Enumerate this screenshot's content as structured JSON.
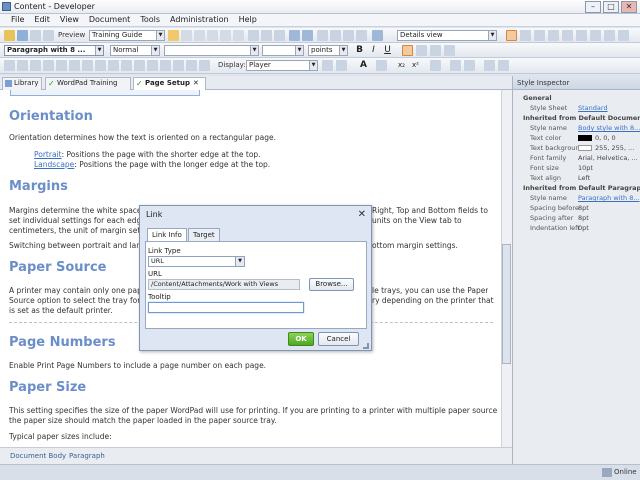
{
  "window": {
    "title": "Content - Developer"
  },
  "menu": [
    "File",
    "Edit",
    "View",
    "Document",
    "Tools",
    "Administration",
    "Help"
  ],
  "toolbar1": {
    "preview_label": "Preview",
    "guide_select": "Training Guide",
    "view_select": "Details view"
  },
  "toolbar2": {
    "style_select": "Paragraph with 8 ...",
    "font_select": "Normal",
    "size_units": "points"
  },
  "toolbar3": {
    "display_label": "Display:",
    "display_select": "Player"
  },
  "tabs": [
    {
      "label": "Library"
    },
    {
      "label": "WordPad Training"
    },
    {
      "label": "Page Setup"
    }
  ],
  "document": {
    "orientation": {
      "heading": "Orientation",
      "body": "Orientation determines how the text is oriented on a rectangular page.",
      "portrait_link": "Portrait",
      "portrait_text": ": Positions the page with the shorter edge at the top.",
      "landscape_link": "Landscape",
      "landscape_text": ": Positions the page with the longer edge at the top."
    },
    "margins": {
      "heading": "Margins",
      "line1": "Margins determine the white space",
      "line1b": "Right, Top and Bottom fields to",
      "line2": "set individual settings for each edge",
      "line2b": "units on the View tab to",
      "line3": "centimeters, the unit of margin sett",
      "line4": "Switching between portrait and land",
      "line4b": "ottom margin settings."
    },
    "paper_source": {
      "heading": "Paper Source",
      "line1": "A printer may contain only one pape",
      "line1b": "le trays, you can use the Paper",
      "line2": "Source option to select the tray for",
      "line2b": "ry depending on the printer that",
      "line3": "is set as the default printer."
    },
    "page_numbers": {
      "heading": "Page Numbers",
      "body": "Enable Print Page Numbers to include a page number on each page."
    },
    "paper_size": {
      "heading": "Paper Size",
      "line1": "This setting specifies the size of the paper WordPad will use for printing. If you are printing to a printer with multiple paper sources,",
      "line2": "the paper size should match the paper loaded in the paper source tray.",
      "line3": "Typical paper sizes include:"
    }
  },
  "status": {
    "item1": "Document Body",
    "item2": "Paragraph"
  },
  "bottom": {
    "status": "Online"
  },
  "inspector": {
    "title": "Style Inspector",
    "general": "General",
    "style_sheet_k": "Style Sheet",
    "style_sheet_v": "Standard",
    "inherited1": "Inherited from Default Document",
    "style_name_k": "Style name",
    "style_name_v": "Body style with 8...",
    "text_color_k": "Text color",
    "text_color_v": "0, 0, 0",
    "text_bg_k": "Text backgrour",
    "text_bg_v": "255, 255, ...",
    "font_family_k": "Font family",
    "font_family_v": "Arial, Helvetica, ...",
    "font_size_k": "Font size",
    "font_size_v": "10pt",
    "text_align_k": "Text align",
    "text_align_v": "Left",
    "inherited2": "Inherited from Default Paragraph",
    "style_name2_k": "Style name",
    "style_name2_v": "Paragraph with 8...",
    "spacing_before_k": "Spacing before",
    "spacing_before_v": "8pt",
    "spacing_after_k": "Spacing after",
    "spacing_after_v": "8pt",
    "indent_k": "Indentation left",
    "indent_v": "0pt"
  },
  "dialog": {
    "title": "Link",
    "tab_link_info": "Link Info",
    "tab_target": "Target",
    "link_type_label": "Link Type",
    "link_type_value": "URL",
    "url_label": "URL",
    "url_value": "/Content/Attachments/Work with Views",
    "browse": "Browse...",
    "tooltip_label": "Tooltip",
    "tooltip_value": "",
    "ok": "OK",
    "cancel": "Cancel"
  },
  "colors": {
    "heading": "#6b8ec9",
    "link": "#3a6fc4",
    "ok": "#4da821"
  }
}
